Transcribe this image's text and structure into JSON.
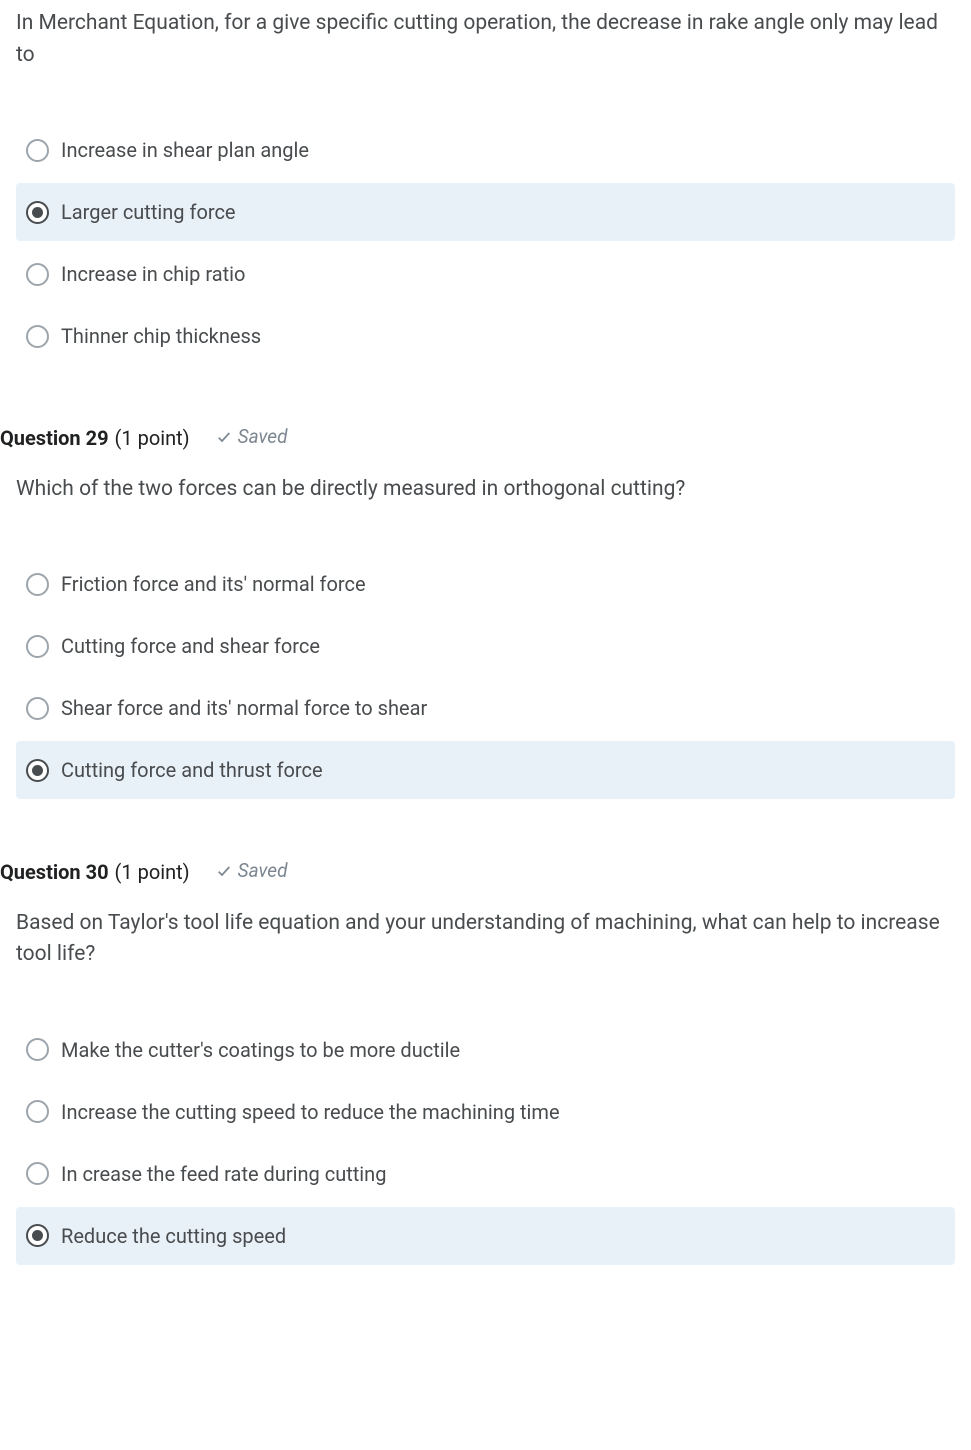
{
  "q28": {
    "text": "In Merchant Equation, for a give specific cutting operation, the decrease in rake angle only may lead to",
    "options": [
      {
        "label": "Increase in shear plan angle",
        "selected": false
      },
      {
        "label": "Larger cutting force",
        "selected": true
      },
      {
        "label": "Increase in chip ratio",
        "selected": false
      },
      {
        "label": "Thinner chip thickness",
        "selected": false
      }
    ]
  },
  "q29": {
    "title": "Question 29",
    "points": "(1 point)",
    "saved": "Saved",
    "text": "Which of the two forces can be directly measured in orthogonal cutting?",
    "options": [
      {
        "label": "Friction force and its' normal force",
        "selected": false
      },
      {
        "label": "Cutting force and shear force",
        "selected": false
      },
      {
        "label": "Shear force and its' normal force to shear",
        "selected": false
      },
      {
        "label": "Cutting force and thrust force",
        "selected": true
      }
    ]
  },
  "q30": {
    "title": "Question 30",
    "points": "(1 point)",
    "saved": "Saved",
    "text": "Based on Taylor's tool life equation and your understanding of machining, what can help to increase tool life?",
    "options": [
      {
        "label": "Make the cutter's coatings to be more ductile",
        "selected": false
      },
      {
        "label": "Increase the cutting speed to reduce the machining time",
        "selected": false
      },
      {
        "label": "In crease the feed rate during cutting",
        "selected": false
      },
      {
        "label": "Reduce the cutting speed",
        "selected": true
      }
    ]
  }
}
